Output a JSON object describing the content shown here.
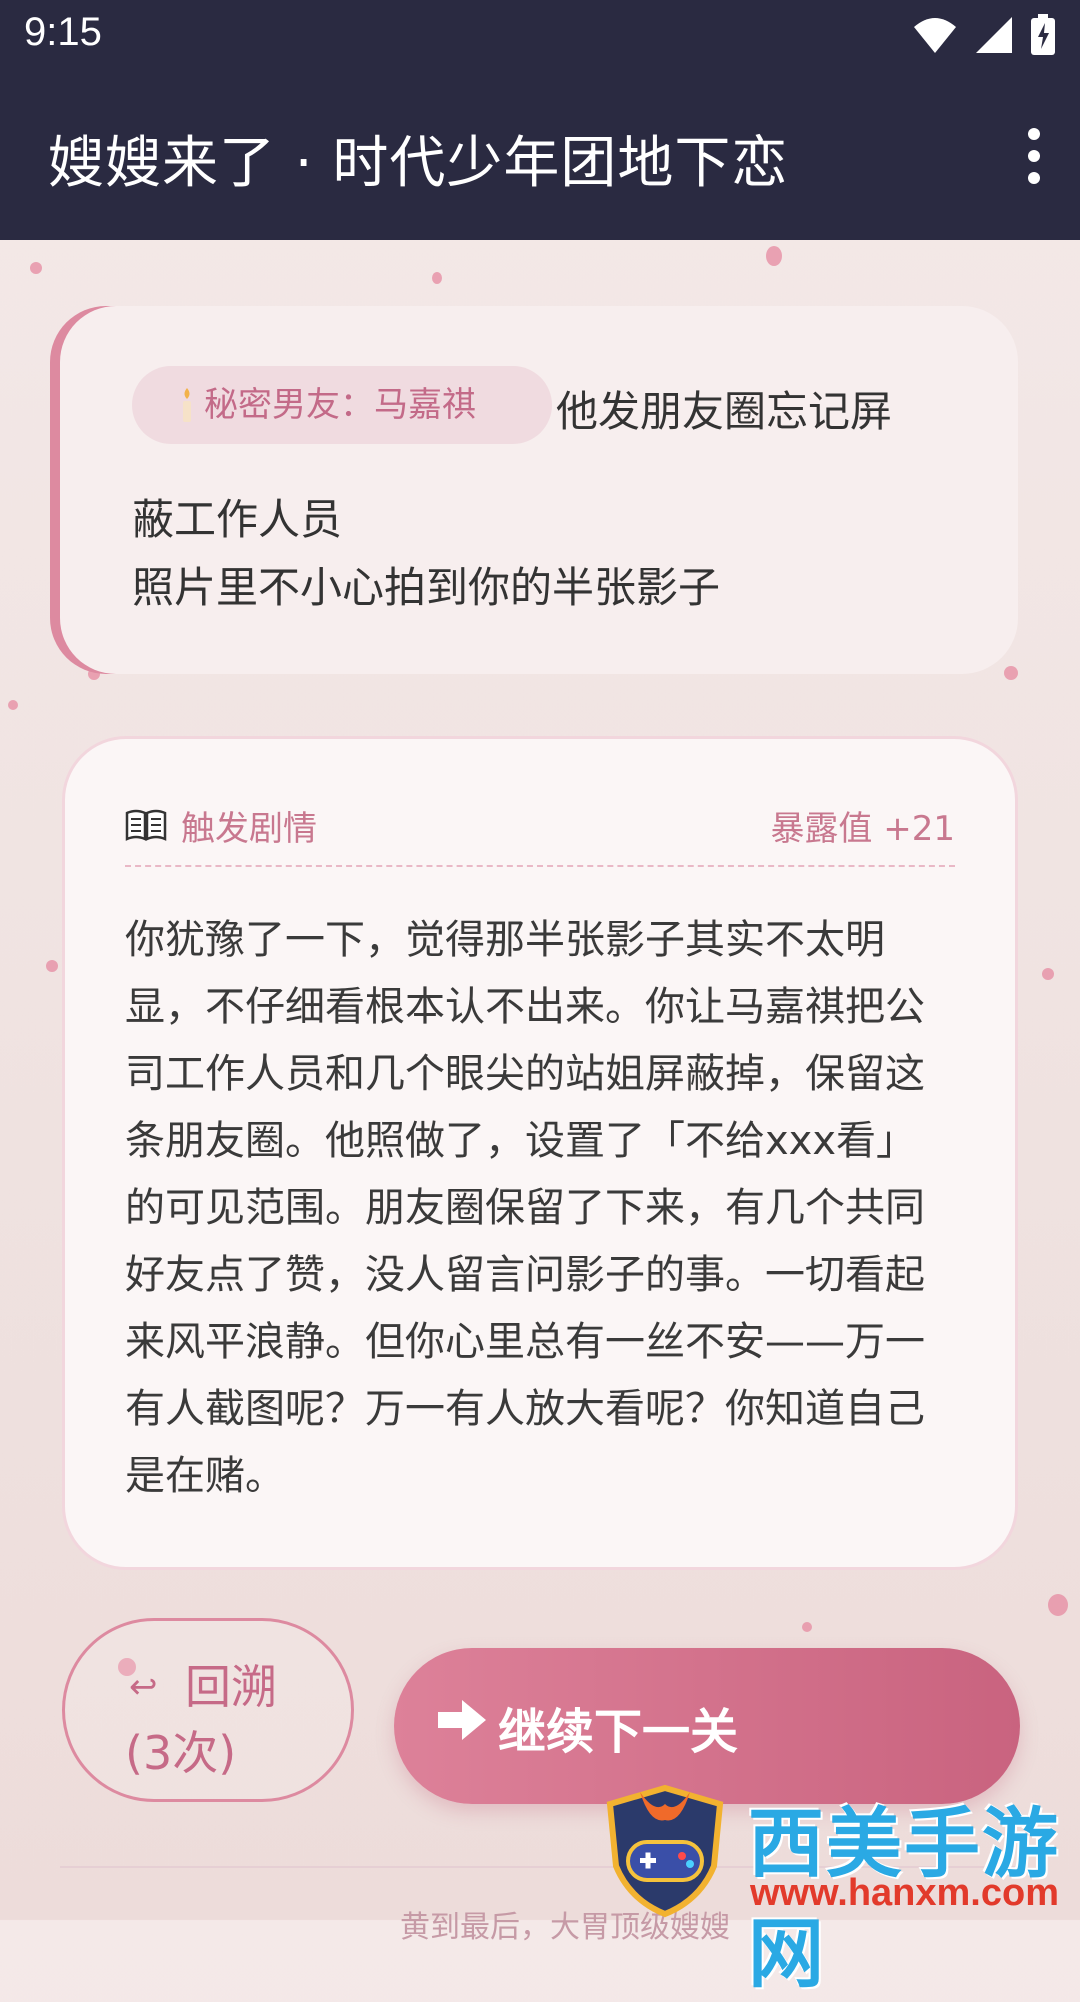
{
  "status_bar": {
    "time": "9:15"
  },
  "app_bar": {
    "title": "嫂嫂来了 · 时代少年团地下恋"
  },
  "message_card": {
    "tag": "秘密男友：马嘉祺",
    "lines": [
      "他发朋友圈忘记屏",
      "蔽工作人员",
      "照片里不小心拍到你的半张影子"
    ]
  },
  "story_card": {
    "trigger_label": "触发剧情",
    "exposure": "暴露值 +21",
    "text": "你犹豫了一下，觉得那半张影子其实不太明显，不仔细看根本认不出来。你让马嘉祺把公司工作人员和几个眼尖的站姐屏蔽掉，保留这条朋友圈。他照做了，设置了「不给xxx看」的可见范围。朋友圈保留了下来，有几个共同好友点了赞，没人留言问影子的事。一切看起来风平浪静。但你心里总有一丝不安——万一有人截图呢？万一有人放大看呢？你知道自己是在赌。"
  },
  "buttons": {
    "back_label": "回溯",
    "back_count": "(3次)",
    "next_label": "继续下一关"
  },
  "footer": {
    "text": "黄到最后，大胃顶级嫂嫂"
  },
  "watermark": {
    "title": "西美手游网",
    "url": "www.hanxm.com"
  },
  "colors": {
    "app_bar": "#2a2a41",
    "accent": "#dd8aa0",
    "button": "#c9637f"
  }
}
